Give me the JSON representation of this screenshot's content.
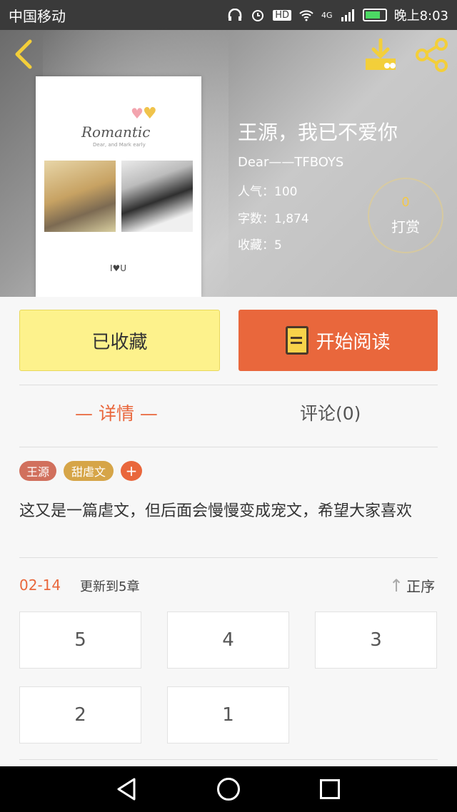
{
  "status_bar": {
    "carrier": "中国移动",
    "time": "晚上8:03",
    "network": "4G"
  },
  "header": {
    "back_icon": "chevron-left-icon",
    "download_icon": "download-icon",
    "share_icon": "share-icon"
  },
  "cover": {
    "title": "Romantic",
    "subtitle": "Dear, and Mark early",
    "signature": "I♥U"
  },
  "book": {
    "title": "王源，我已不爱你",
    "author": "Dear——TFBOYS",
    "popularity": "人气：100",
    "word_count": "字数：1,874",
    "favorites": "收藏：5"
  },
  "reward": {
    "count": "0",
    "label": "打赏"
  },
  "actions": {
    "collected_label": "已收藏",
    "read_label": "开始阅读"
  },
  "tabs": {
    "detail": "— 详情 —",
    "comment": "评论(0)"
  },
  "tags": [
    "王源",
    "甜虐文"
  ],
  "tag_add": "+",
  "description": "这又是一篇虐文，但后面会慢慢变成宠文，希望大家喜欢",
  "updates": {
    "date": "02-14",
    "text": "更新到5章",
    "sort_label": "正序"
  },
  "chapters": [
    "5",
    "4",
    "3",
    "2",
    "1"
  ],
  "colors": {
    "accent": "#e9673c",
    "collect_bg": "#fdf28c",
    "tag_wangyuan": "#d1705d",
    "tag_tiannue": "#d6a548"
  }
}
